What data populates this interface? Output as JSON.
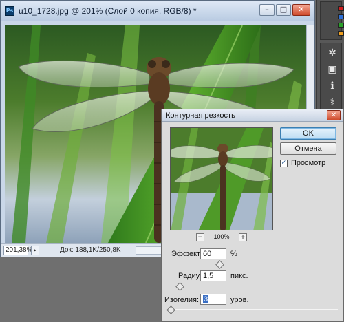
{
  "document": {
    "title": "u10_1728.jpg @ 201% (Слой 0 копия, RGB/8) *",
    "app_icon_text": "Ps",
    "window_buttons": {
      "minimize": "–",
      "maximize": "□",
      "close": "✕"
    },
    "status": {
      "zoom": "201,38%",
      "doc_info": "Док: 188,1K/250,8K"
    }
  },
  "dialog": {
    "title": "Контурная резкость",
    "close": "✕",
    "buttons": {
      "ok": "OK",
      "cancel": "Отмена"
    },
    "preview_checkbox": {
      "label": "Просмотр",
      "checked": true,
      "mark": "✓"
    },
    "zoom": {
      "minus": "−",
      "plus": "+",
      "value": "100%"
    },
    "params": {
      "amount": {
        "label": "Эффект:",
        "value": "60",
        "unit": "%",
        "slider_fraction": 0.3
      },
      "radius": {
        "label": "Радиус:",
        "value": "1,5",
        "unit": "пикс.",
        "slider_fraction": 0.06
      },
      "threshold": {
        "label": "Изогелия:",
        "value": "3",
        "unit": "уров.",
        "slider_fraction": 0.01
      }
    }
  },
  "right_panel": {
    "icons": [
      "gear-icon",
      "image-icon",
      "info-icon",
      "brush-icon"
    ],
    "icon_glyphs": [
      "✲",
      "▣",
      "ℹ",
      "⚕"
    ],
    "swatch_colors": [
      "#d02020",
      "#2d6fd6",
      "#2aa02a",
      "#f0a020"
    ]
  }
}
